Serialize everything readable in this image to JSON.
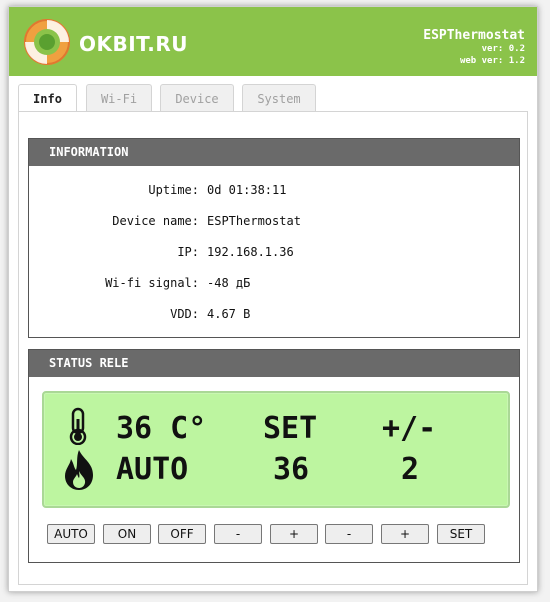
{
  "header": {
    "brand": "OKBIT.RU",
    "title": "ESPThermostat",
    "ver": "ver: 0.2",
    "web_ver": "web ver: 1.2",
    "accent": "#8bc34a"
  },
  "tabs": [
    "Info",
    "Wi-Fi",
    "Device",
    "System"
  ],
  "info": {
    "heading": "INFORMATION",
    "rows": [
      {
        "label": "Uptime:",
        "value": "0d 01:38:11"
      },
      {
        "label": "Device name:",
        "value": "ESPThermostat"
      },
      {
        "label": "IP:",
        "value": "192.168.1.36"
      },
      {
        "label": "Wi-fi signal:",
        "value": "-48 дБ"
      },
      {
        "label": "VDD:",
        "value": "4.67 В"
      }
    ]
  },
  "status": {
    "heading": "STATUS RELE",
    "lcd": {
      "temp": "36 C°",
      "set_label": "SET",
      "hyst_label": "+/-",
      "mode": "AUTO",
      "set_value": "36",
      "hyst_value": "2",
      "background": "#bdf5a0"
    },
    "buttons": [
      "AUTO",
      "ON",
      "OFF",
      "-",
      "+",
      "-",
      "+",
      "SET"
    ]
  }
}
